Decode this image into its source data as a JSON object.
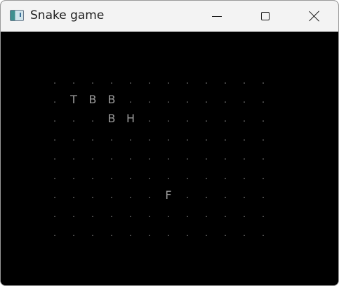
{
  "window": {
    "title": "Snake game",
    "icon": "app-window-icon",
    "controls": [
      "minimize",
      "maximize",
      "close"
    ]
  },
  "board": {
    "rows": 10,
    "cols": 12,
    "cells": [
      [
        ".",
        ".",
        ".",
        ".",
        ".",
        ".",
        ".",
        ".",
        ".",
        ".",
        ".",
        "."
      ],
      [
        ".",
        "T",
        "B",
        "B",
        ".",
        ".",
        ".",
        ".",
        ".",
        ".",
        ".",
        "."
      ],
      [
        ".",
        ".",
        ".",
        "B",
        "H",
        ".",
        ".",
        ".",
        ".",
        ".",
        ".",
        "."
      ],
      [
        ".",
        ".",
        ".",
        ".",
        ".",
        ".",
        ".",
        ".",
        ".",
        ".",
        ".",
        "."
      ],
      [
        ".",
        ".",
        ".",
        ".",
        ".",
        ".",
        ".",
        ".",
        ".",
        ".",
        ".",
        "."
      ],
      [
        ".",
        ".",
        ".",
        ".",
        ".",
        ".",
        ".",
        ".",
        ".",
        ".",
        ".",
        "."
      ],
      [
        ".",
        ".",
        ".",
        ".",
        ".",
        ".",
        "F",
        ".",
        ".",
        ".",
        ".",
        "."
      ],
      [
        ".",
        ".",
        ".",
        ".",
        ".",
        ".",
        ".",
        ".",
        ".",
        ".",
        ".",
        "."
      ],
      [
        ".",
        ".",
        ".",
        ".",
        ".",
        ".",
        ".",
        ".",
        ".",
        ".",
        ".",
        "."
      ]
    ],
    "colors": {
      "background": "#000000",
      "glyph": "#9a9a9a"
    }
  }
}
